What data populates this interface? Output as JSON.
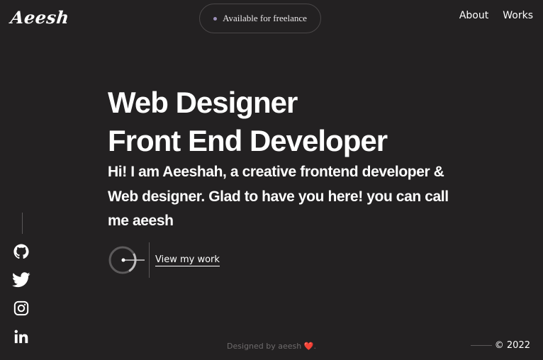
{
  "header": {
    "logo": "Aeesh",
    "availability": "Available for freelance",
    "nav": [
      "About",
      "Works"
    ]
  },
  "hero": {
    "title_line1": "Web Designer",
    "title_line2": "Front End Developer",
    "intro": "Hi! I am Aeeshah, a creative frontend developer & Web designer. Glad to have you here! you can call me aeesh"
  },
  "cta": {
    "label": "View my work"
  },
  "social": {
    "icons": [
      "github-icon",
      "twitter-icon",
      "instagram-icon",
      "linkedin-icon"
    ]
  },
  "footer": {
    "credit_prefix": "Designed by aeesh",
    "credit_suffix": ".",
    "heart": "❤️",
    "copyright": "© 2022"
  },
  "colors": {
    "background": "#232122",
    "text": "#ffffff",
    "muted": "#6e6b6c",
    "pill_dot": "#9b8fb8",
    "heart": "#e0334a"
  }
}
